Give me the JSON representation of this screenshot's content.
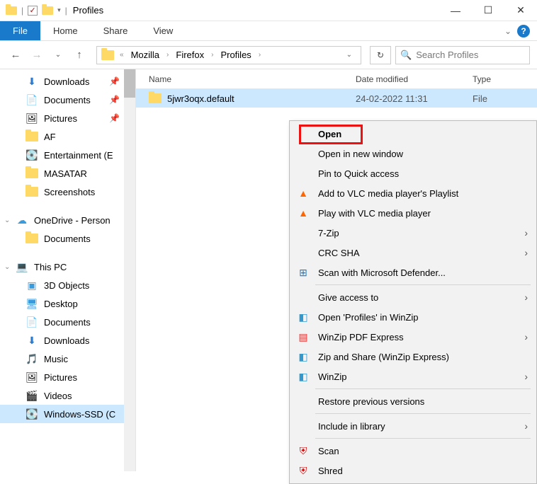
{
  "window": {
    "title": "Profiles"
  },
  "ribbon": {
    "file": "File",
    "home": "Home",
    "share": "Share",
    "view": "View"
  },
  "breadcrumb": {
    "a": "Mozilla",
    "b": "Firefox",
    "c": "Profiles"
  },
  "search": {
    "placeholder": "Search Profiles"
  },
  "columns": {
    "name": "Name",
    "date": "Date modified",
    "type": "Type"
  },
  "file": {
    "name": "5jwr3oqx.default",
    "date": "24-02-2022 11:31",
    "type": "File"
  },
  "sidebar": {
    "downloads": "Downloads",
    "documents": "Documents",
    "pictures": "Pictures",
    "af": "AF",
    "ent": "Entertainment (E",
    "masatar": "MASATAR",
    "screenshots": "Screenshots",
    "onedrive": "OneDrive - Person",
    "od_docs": "Documents",
    "thispc": "This PC",
    "obj3d": "3D Objects",
    "desktop": "Desktop",
    "docs2": "Documents",
    "downloads2": "Downloads",
    "music": "Music",
    "pictures2": "Pictures",
    "videos": "Videos",
    "ssd": "Windows-SSD (C"
  },
  "cm": {
    "open": "Open",
    "open_new": "Open in new window",
    "pin": "Pin to Quick access",
    "vlc_add": "Add to VLC media player's Playlist",
    "vlc_play": "Play with VLC media player",
    "zip7": "7-Zip",
    "crc": "CRC SHA",
    "defender": "Scan with Microsoft Defender...",
    "give": "Give access to",
    "winzip_open": "Open 'Profiles' in WinZip",
    "winzip_pdf": "WinZip PDF Express",
    "winzip_share": "Zip and Share (WinZip Express)",
    "winzip": "WinZip",
    "restore": "Restore previous versions",
    "include": "Include in library",
    "scan": "Scan",
    "shred": "Shred"
  }
}
